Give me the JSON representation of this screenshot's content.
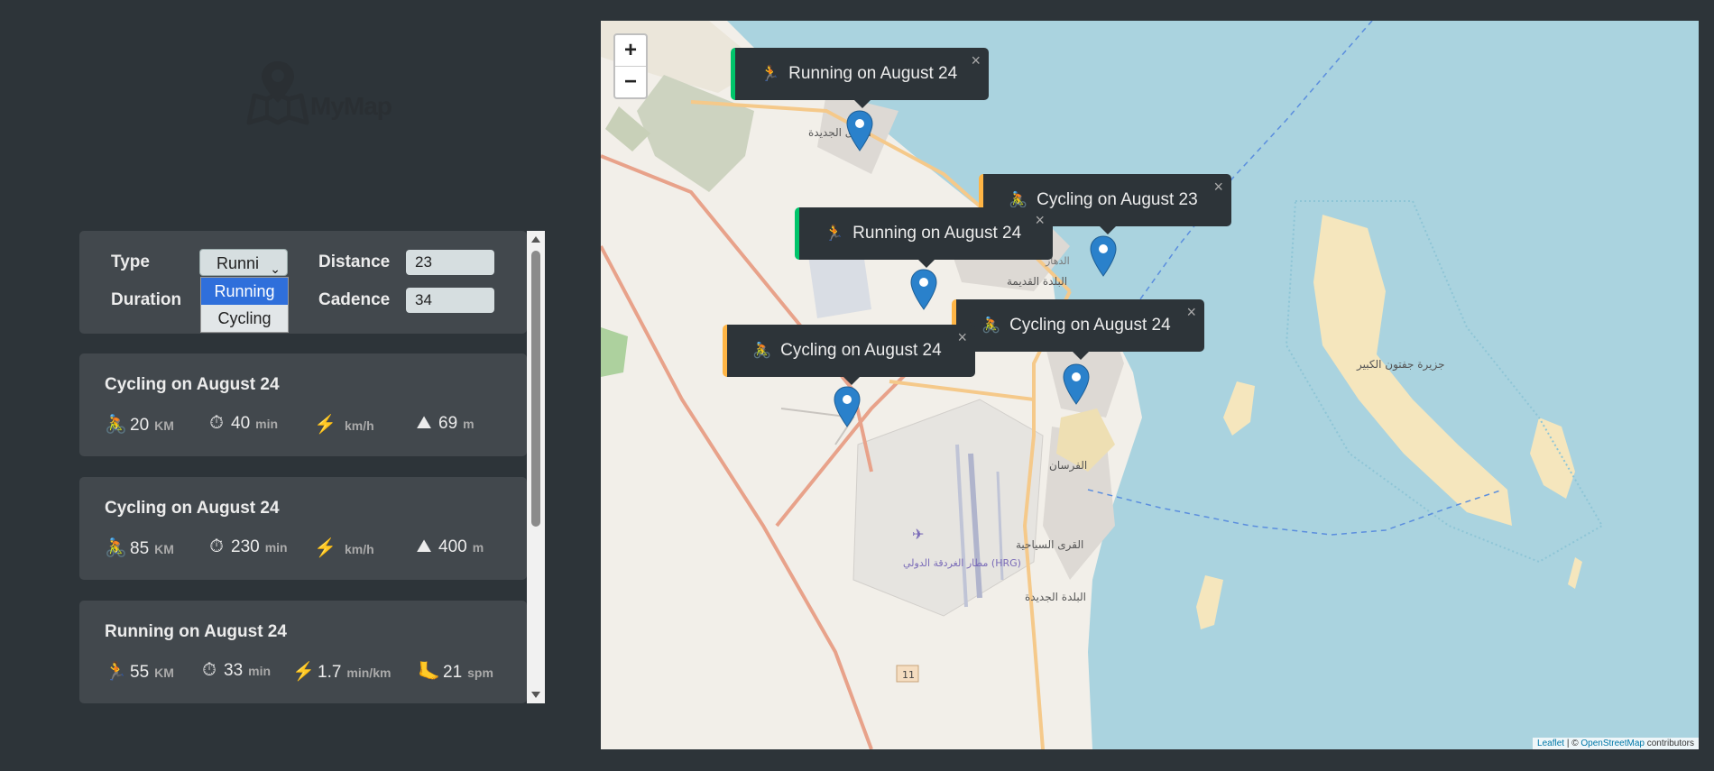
{
  "logo": {
    "text": "MyMap",
    "icon": "map-pin-icon"
  },
  "form": {
    "type_label": "Type",
    "type_selected": "Runni",
    "type_options": [
      "Running",
      "Cycling"
    ],
    "distance_label": "Distance",
    "distance_value": "23",
    "duration_label": "Duration",
    "cadence_label": "Cadence",
    "cadence_value": "34"
  },
  "workouts": [
    {
      "title": "Cycling on August 24",
      "details": [
        {
          "icon": "🚴",
          "value": "20",
          "unit": "KM"
        },
        {
          "icon": "⏱",
          "value": "40",
          "unit": "min"
        },
        {
          "icon": "⚡️",
          "value": "",
          "unit": "km/h"
        },
        {
          "icon": "⛰",
          "value": "69",
          "unit": "m"
        }
      ]
    },
    {
      "title": "Cycling on August 24",
      "details": [
        {
          "icon": "🚴",
          "value": "85",
          "unit": "KM"
        },
        {
          "icon": "⏱",
          "value": "230",
          "unit": "min"
        },
        {
          "icon": "⚡️",
          "value": "",
          "unit": "km/h"
        },
        {
          "icon": "⛰",
          "value": "400",
          "unit": "m"
        }
      ]
    },
    {
      "title": "Running on August 24",
      "details": [
        {
          "icon": "🏃",
          "value": "55",
          "unit": "KM"
        },
        {
          "icon": "⏱",
          "value": "33",
          "unit": "min"
        },
        {
          "icon": "⚡️",
          "value": "1.7",
          "unit": "min/km"
        },
        {
          "icon": "🦶",
          "value": "21",
          "unit": "spm"
        }
      ]
    }
  ],
  "map": {
    "zoom_in": "+",
    "zoom_out": "−",
    "attribution_leaflet": "Leaflet",
    "attribution_sep": " | © ",
    "attribution_osm": "OpenStreetMap",
    "attribution_tail": " contributors",
    "labels": {
      "new_villages": "القرى الجديدة",
      "old_town": "البلدة القديمة",
      "dahar": "الدهار",
      "fursan": "الفرسان",
      "tourist_villages": "القرى السياحية",
      "new_town": "البلدة الجديدة",
      "airport": "مطار الغردقة الدولي (HRG)",
      "island": "جزيرة جفتون الكبير",
      "road_no": "11"
    },
    "popups": [
      {
        "type": "running",
        "icon": "🏃",
        "text": "Running on August 24",
        "close": "×"
      },
      {
        "type": "cycling",
        "icon": "🚴",
        "text": "Cycling on August 23",
        "close": "×"
      },
      {
        "type": "running",
        "icon": "🏃",
        "text": "Running on August 24",
        "close": "×"
      },
      {
        "type": "cycling",
        "icon": "🚴",
        "text": "Cycling on August 24",
        "close": "×"
      },
      {
        "type": "cycling",
        "icon": "🚴",
        "text": "Cycling on August 24",
        "close": "×"
      }
    ]
  },
  "colors": {
    "background": "#2d3439",
    "card": "#42484d",
    "running_accent": "#00c46a",
    "cycling_accent": "#ffb545",
    "sea": "#aad3df",
    "land": "#f2efe9",
    "marker": "#2a81cb"
  }
}
